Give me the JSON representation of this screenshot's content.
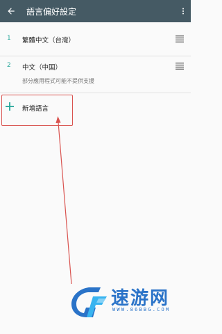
{
  "app_bar": {
    "title": "語言偏好設定",
    "back_icon": "arrow-back-icon",
    "menu_icon": "more-vert-icon",
    "background": "#455a64"
  },
  "languages": [
    {
      "index": "1",
      "name": "繁體中文（台灣）",
      "note": ""
    },
    {
      "index": "2",
      "name": "中文（中国）",
      "note": "部分應用程式可能不提供支援"
    }
  ],
  "add_language": {
    "label": "新增語言",
    "icon": "plus-icon"
  },
  "accent_color": "#26a69a",
  "annotation": {
    "color": "#d9534f"
  },
  "watermark": {
    "brand": "速游网",
    "url": "WWW.86BBG.COM",
    "color": "#2a73c8"
  }
}
